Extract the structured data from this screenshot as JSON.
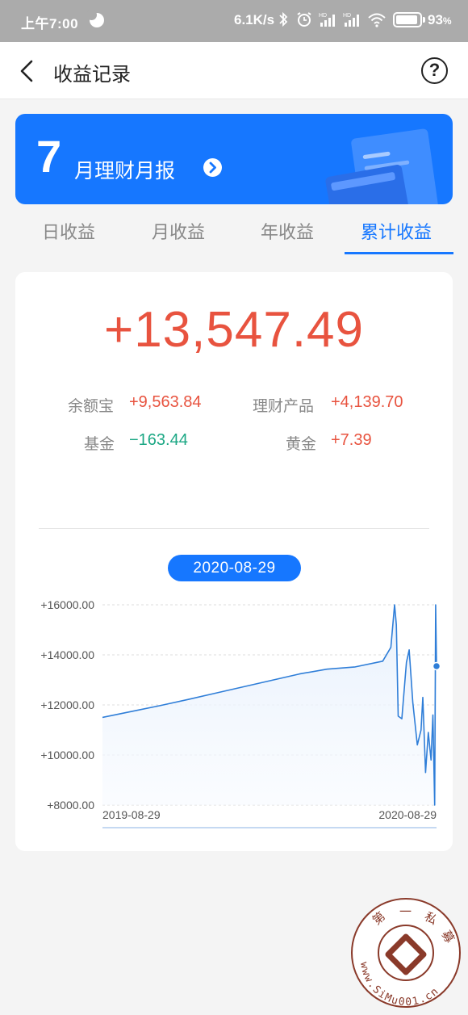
{
  "status_bar": {
    "time": "上午7:00",
    "speed": "6.1K/s",
    "battery": "93",
    "battery_unit": "%",
    "icons": [
      "bluetooth-icon",
      "alarm-icon",
      "hd-signal-icon",
      "hd-signal-icon",
      "wifi-icon",
      "battery-icon"
    ]
  },
  "navbar": {
    "title": "收益记录",
    "help_label": "?"
  },
  "banner": {
    "month": "7",
    "text": "月理财月报"
  },
  "tabs": [
    {
      "label": "日收益",
      "active": false
    },
    {
      "label": "月收益",
      "active": false
    },
    {
      "label": "年收益",
      "active": false
    },
    {
      "label": "累计收益",
      "active": true
    }
  ],
  "summary": {
    "total": "+13,547.49",
    "categories": [
      {
        "label": "余额宝",
        "value": "+9,563.84",
        "sign": "pos"
      },
      {
        "label": "理财产品",
        "value": "+4,139.70",
        "sign": "pos"
      },
      {
        "label": "基金",
        "value": "−163.44",
        "sign": "neg"
      },
      {
        "label": "黄金",
        "value": "+7.39",
        "sign": "pos"
      }
    ]
  },
  "selected_date": "2020-08-29",
  "colors": {
    "accent": "#1677ff",
    "positive": "#e8533f",
    "negative": "#1ba784"
  },
  "chart_data": {
    "type": "area",
    "ylim": [
      8000,
      16000
    ],
    "ytick_labels": [
      "+16000.00",
      "+14000.00",
      "+12000.00",
      "+10000.00",
      "+8000.00"
    ],
    "yticks": [
      16000,
      14000,
      12000,
      10000,
      8000
    ],
    "xtick_labels": [
      "2019-08-29",
      "2020-08-29"
    ],
    "xlim": [
      "2019-08-29",
      "2020-08-29"
    ],
    "grid": true,
    "series": [
      {
        "values": [
          [
            "2019-08-29",
            11500
          ],
          [
            "2019-10-01",
            11750
          ],
          [
            "2019-11-01",
            11980
          ],
          [
            "2019-12-01",
            12220
          ],
          [
            "2020-01-01",
            12480
          ],
          [
            "2020-02-01",
            12740
          ],
          [
            "2020-03-01",
            12980
          ],
          [
            "2020-04-01",
            13240
          ],
          [
            "2020-05-01",
            13430
          ],
          [
            "2020-06-01",
            13520
          ],
          [
            "2020-07-01",
            13750
          ],
          [
            "2020-07-10",
            14300
          ],
          [
            "2020-07-14",
            16000
          ],
          [
            "2020-07-16",
            15200
          ],
          [
            "2020-07-18",
            11550
          ],
          [
            "2020-07-22",
            11450
          ],
          [
            "2020-07-27",
            13700
          ],
          [
            "2020-07-30",
            14200
          ],
          [
            "2020-08-03",
            12100
          ],
          [
            "2020-08-08",
            10400
          ],
          [
            "2020-08-12",
            11000
          ],
          [
            "2020-08-14",
            12300
          ],
          [
            "2020-08-17",
            9300
          ],
          [
            "2020-08-20",
            10900
          ],
          [
            "2020-08-23",
            9800
          ],
          [
            "2020-08-25",
            11600
          ],
          [
            "2020-08-27",
            8000
          ],
          [
            "2020-08-28",
            16000
          ],
          [
            "2020-08-29",
            13547.49
          ]
        ]
      }
    ],
    "highlight": {
      "x": "2020-08-29",
      "y": 13547.49
    }
  },
  "watermark": {
    "chars": [
      "第",
      "一",
      "私",
      "募"
    ],
    "url": "www.SiMu001.cn"
  }
}
